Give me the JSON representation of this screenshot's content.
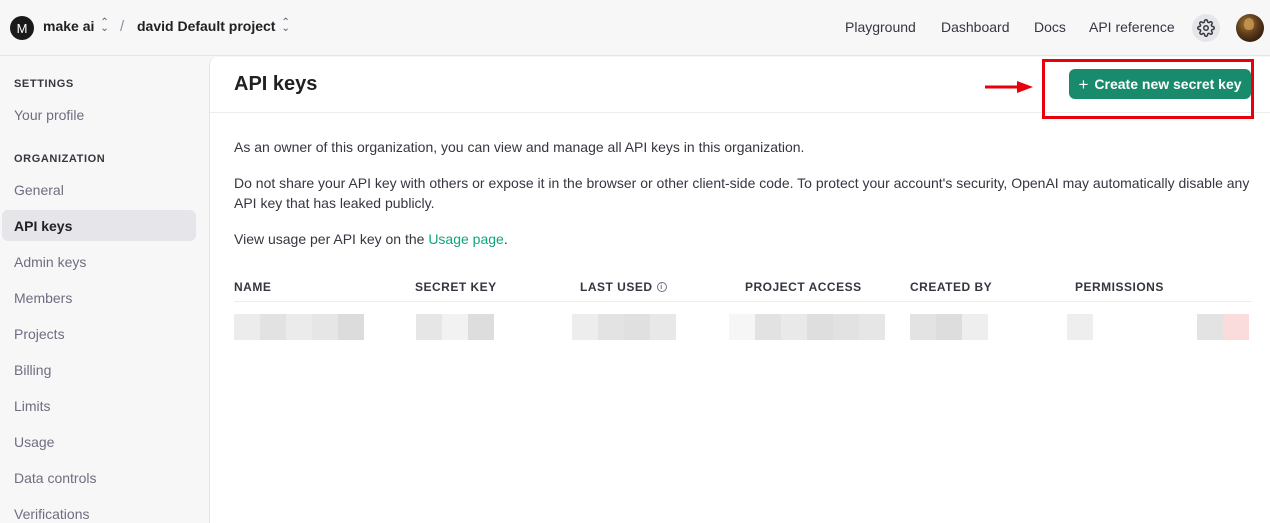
{
  "topbar": {
    "org_initial": "M",
    "org_name": "make ai",
    "separator": "/",
    "project_name": "david Default project",
    "nav": [
      "Playground",
      "Dashboard",
      "Docs",
      "API reference"
    ]
  },
  "sidebar": {
    "settings_heading": "SETTINGS",
    "your_profile": "Your profile",
    "organization_heading": "ORGANIZATION",
    "items": [
      "General",
      "API keys",
      "Admin keys",
      "Members",
      "Projects",
      "Billing",
      "Limits",
      "Usage",
      "Data controls",
      "Verifications"
    ],
    "active_item": "API keys"
  },
  "main": {
    "title": "API keys",
    "create_button": "Create new secret key",
    "paragraph1": "As an owner of this organization, you can view and manage all API keys in this organization.",
    "paragraph2": "Do not share your API key with others or expose it in the browser or other client-side code. To protect your account's security, OpenAI may automatically disable any API key that has leaked publicly.",
    "paragraph3_prefix": "View usage per API key on the ",
    "paragraph3_link": "Usage page",
    "paragraph3_suffix": ".",
    "table": {
      "columns": [
        "NAME",
        "SECRET KEY",
        "LAST USED",
        "PROJECT ACCESS",
        "CREATED BY",
        "PERMISSIONS"
      ],
      "rows_redacted": 1
    }
  },
  "colors": {
    "accent": "#198a6b",
    "link": "#10a37f",
    "highlight": "#e8000b"
  },
  "icons": [
    "chevron-updown-icon",
    "gear-icon",
    "info-icon",
    "plus-icon",
    "arrow-annotation-icon"
  ]
}
